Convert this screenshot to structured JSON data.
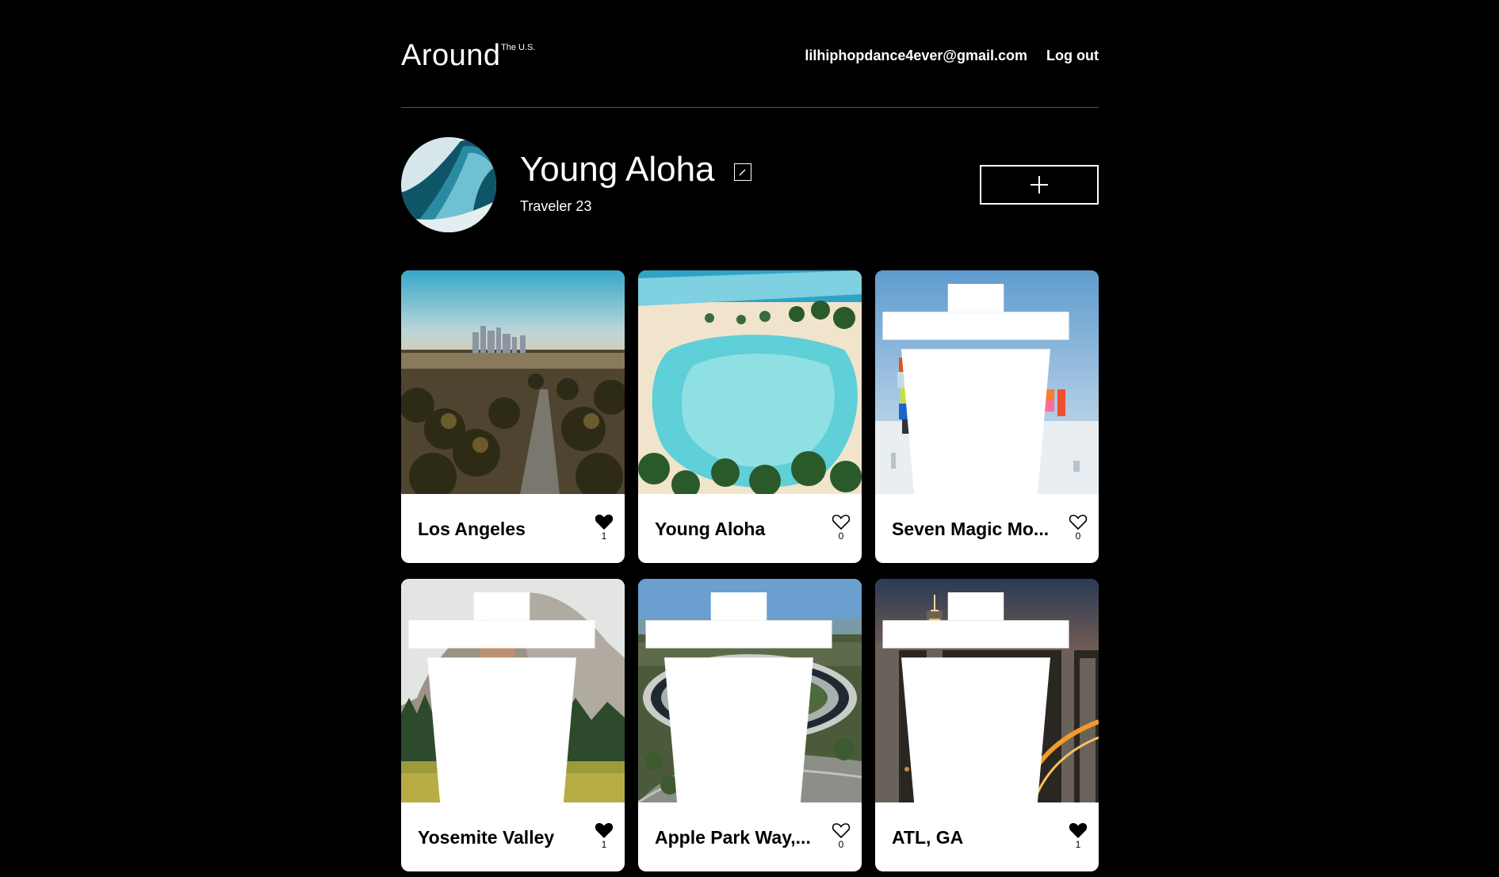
{
  "header": {
    "logo": "Around",
    "logo_sup": "The U.S.",
    "email": "lilhiphopdance4ever@gmail.com",
    "logout_label": "Log out"
  },
  "profile": {
    "name": "Young Aloha",
    "description": "Traveler 23",
    "add_icon": "plus-icon",
    "edit_icon": "pencil-icon"
  },
  "cards": [
    {
      "title": "Los Angeles",
      "likes": "1",
      "liked": true,
      "deletable": false,
      "image": "city-skyline-palms"
    },
    {
      "title": "Young Aloha",
      "likes": "0",
      "liked": false,
      "deletable": false,
      "image": "tropical-lagoon"
    },
    {
      "title": "Seven Magic Mo...",
      "likes": "0",
      "liked": false,
      "deletable": true,
      "image": "colorful-rock-stacks"
    },
    {
      "title": "Yosemite Valley",
      "likes": "1",
      "liked": true,
      "deletable": true,
      "image": "granite-dome-forest"
    },
    {
      "title": "Apple Park Way,...",
      "likes": "0",
      "liked": false,
      "deletable": true,
      "image": "ring-building-aerial"
    },
    {
      "title": "ATL, GA",
      "likes": "1",
      "liked": true,
      "deletable": true,
      "image": "night-city-aerial"
    }
  ],
  "colors": {
    "background": "#000000",
    "card": "#ffffff",
    "text_light": "#ffffff",
    "text_dark": "#000000",
    "divider": "#545454"
  }
}
